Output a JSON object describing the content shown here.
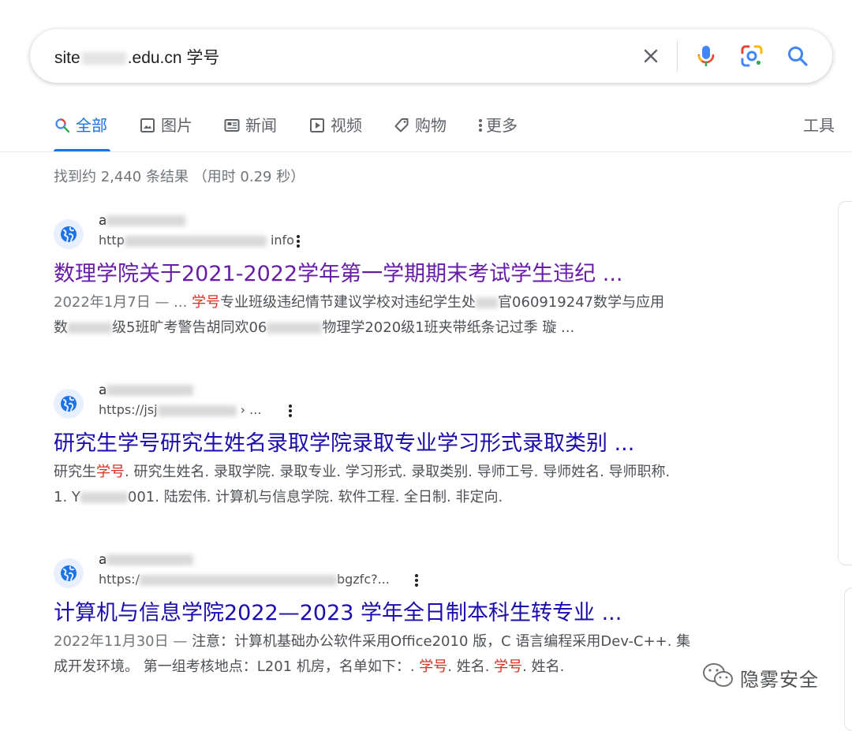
{
  "search": {
    "query_prefix": "site",
    "query_suffix": ".edu.cn 学号"
  },
  "tabs": [
    {
      "label": "全部",
      "icon": "search-icon",
      "active": true
    },
    {
      "label": "图片",
      "icon": "image-icon"
    },
    {
      "label": "新闻",
      "icon": "news-icon"
    },
    {
      "label": "视频",
      "icon": "video-icon"
    },
    {
      "label": "购物",
      "icon": "tag-icon"
    },
    {
      "label": "更多",
      "icon": "more-vert-icon"
    }
  ],
  "tools_label": "工具",
  "stats": "找到约 2,440 条结果  （用时 0.29 秒）",
  "results": [
    {
      "site_name_visible": "a",
      "url_visible_head": "http",
      "url_visible_tail": "info",
      "title": "数理学院关于2021-2022学年第一学期期末考试学生违纪 ...",
      "snippet_line1": {
        "date": "2022年1月7日 — ... ",
        "hl": "学号",
        "text": "专业班级违纪情节建议学校对违纪学生处",
        "text2": "官060919247数学与应用"
      },
      "snippet_line2": {
        "a": "数",
        "b": "级5班旷考警告胡同欢06",
        "c": "物理学2020级1班夹带纸条记过季 璇 ..."
      }
    },
    {
      "site_name_visible": "a",
      "url_visible_head": "https://jsj",
      "url_visible_tail": "› ...",
      "title": "研究生学号研究生姓名录取学院录取专业学习形式录取类别 ...",
      "snippet_line1": {
        "a": "研究生",
        "hl": "学号",
        "b": ". 研究生姓名. 录取学院. 录取专业. 学习形式. 录取类别. 导师工号. 导师姓名. 导师职称."
      },
      "snippet_line2": {
        "a": "1. Y",
        "b": "001. 陆宏伟. 计算机与信息学院. 软件工程. 全日制. 非定向."
      }
    },
    {
      "site_name_visible": "a",
      "url_visible_head": "https:/",
      "url_visible_tail": "bgzfc?...",
      "title": "计算机与信息学院2022—2023 学年全日制本科生转专业 ...",
      "snippet_line1": {
        "date": "2022年11月30日 — ",
        "text": "注意：计算机基础办公软件采用Office2010 版，C 语言编程采用Dev-C++. 集"
      },
      "snippet_line2": {
        "a": "成开发环境。 第一组考核地点：L201 机房，名单如下：. ",
        "hl1": "学号",
        "b": ". 姓名. ",
        "hl2": "学号",
        "c": ". 姓名."
      }
    }
  ],
  "watermark": "隐雾安全",
  "colors": {
    "link": "#1a0dab",
    "visited": "#681da8",
    "accent": "#1a73e8",
    "highlight": "#d93025"
  }
}
